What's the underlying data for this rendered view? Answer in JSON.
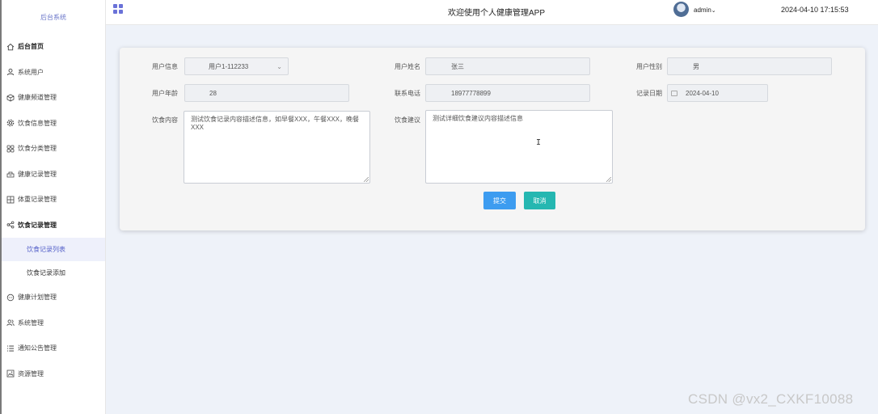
{
  "sidebar": {
    "brand": "后台系统",
    "items": [
      {
        "label": "后台首页",
        "icon": "home-icon"
      },
      {
        "label": "系统用户",
        "icon": "user-icon"
      },
      {
        "label": "健康频道管理",
        "icon": "cube-icon"
      },
      {
        "label": "饮食信息管理",
        "icon": "gear-icon"
      },
      {
        "label": "饮食分类管理",
        "icon": "grid-icon"
      },
      {
        "label": "健康记录管理",
        "icon": "tray-icon"
      },
      {
        "label": "体重记录管理",
        "icon": "table-icon"
      },
      {
        "label": "饮食记录管理",
        "icon": "share-icon"
      }
    ],
    "sub_items": [
      {
        "label": "饮食记录列表"
      },
      {
        "label": "饮食记录添加"
      }
    ],
    "items_after": [
      {
        "label": "健康计划管理",
        "icon": "chat-icon"
      },
      {
        "label": "系统管理",
        "icon": "users-icon"
      },
      {
        "label": "通知公告管理",
        "icon": "list-icon"
      },
      {
        "label": "资源管理",
        "icon": "image-icon"
      }
    ]
  },
  "header": {
    "title": "欢迎使用个人健康管理APP",
    "username": "admin",
    "datetime": "2024-04-10 17:15:53"
  },
  "form": {
    "user_info_label": "用户信息",
    "user_info_value": "用户1-112233",
    "user_name_label": "用户姓名",
    "user_name_value": "张三",
    "gender_label": "用户性别",
    "gender_value": "男",
    "age_label": "用户年龄",
    "age_value": "28",
    "phone_label": "联系电话",
    "phone_value": "18977778899",
    "date_label": "记录日期",
    "date_value": "2024-04-10",
    "diet_content_label": "饮食内容",
    "diet_content_value": "测试饮食记录内容描述信息，如早餐XXX，午餐XXX，晚餐XXX",
    "diet_advice_label": "饮食建议",
    "diet_advice_value": "测试详细饮食建议内容描述信息",
    "submit_label": "提交",
    "cancel_label": "取消"
  },
  "watermark": "CSDN @vx2_CXKF10088",
  "colors": {
    "primary": "#3d9cf0",
    "teal": "#25b7b1",
    "accent": "#6a72d8"
  }
}
